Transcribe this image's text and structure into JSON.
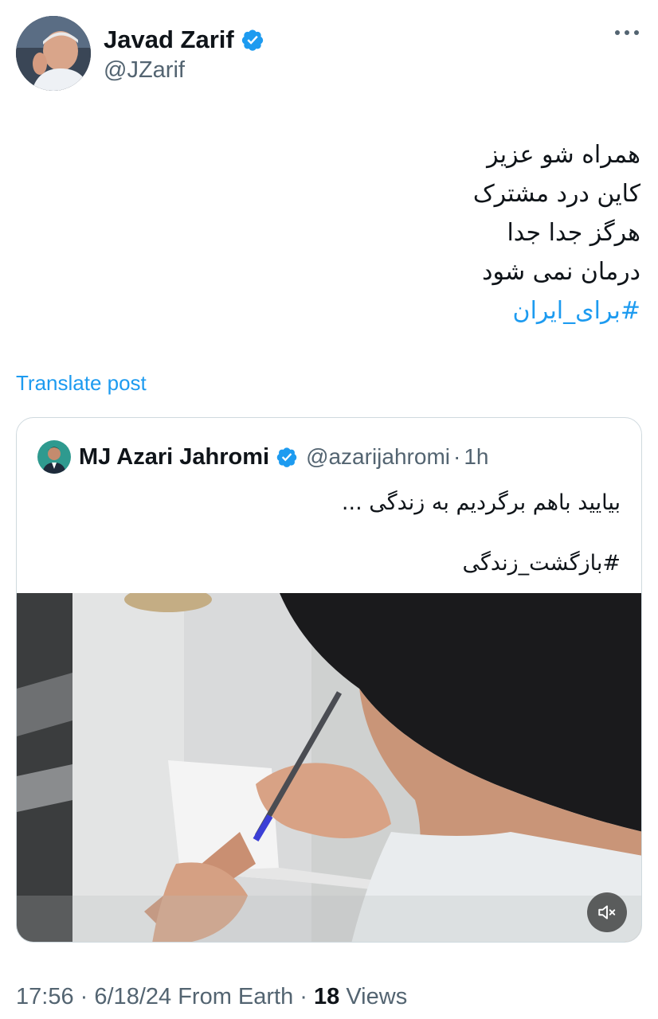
{
  "author": {
    "name": "Javad Zarif",
    "handle": "@JZarif",
    "verified_color": "#1d9bf0"
  },
  "post": {
    "lines": [
      "همراه شو عزیز",
      "کاین درد مشترک",
      "هرگز جدا جدا",
      "درمان نمی شود"
    ],
    "hashtag": "#برای_ایران"
  },
  "translate_label": "Translate post",
  "quoted": {
    "name": "MJ Azari Jahromi",
    "handle": "@azarijahromi",
    "separator": "·",
    "time": "1h",
    "text_line1": "بیایید باهم برگردیم به زندگی ...",
    "hashtag": "#بازگشت_زندگی",
    "media_icon": "mute-icon"
  },
  "meta": {
    "time": "17:56",
    "sep1": "·",
    "date": "6/18/24",
    "source": "From Earth",
    "sep2": "·",
    "views_count": "18",
    "views_label": "Views"
  },
  "colors": {
    "accent": "#1d9bf0",
    "secondary_text": "#536471",
    "border": "#cfd9de"
  }
}
